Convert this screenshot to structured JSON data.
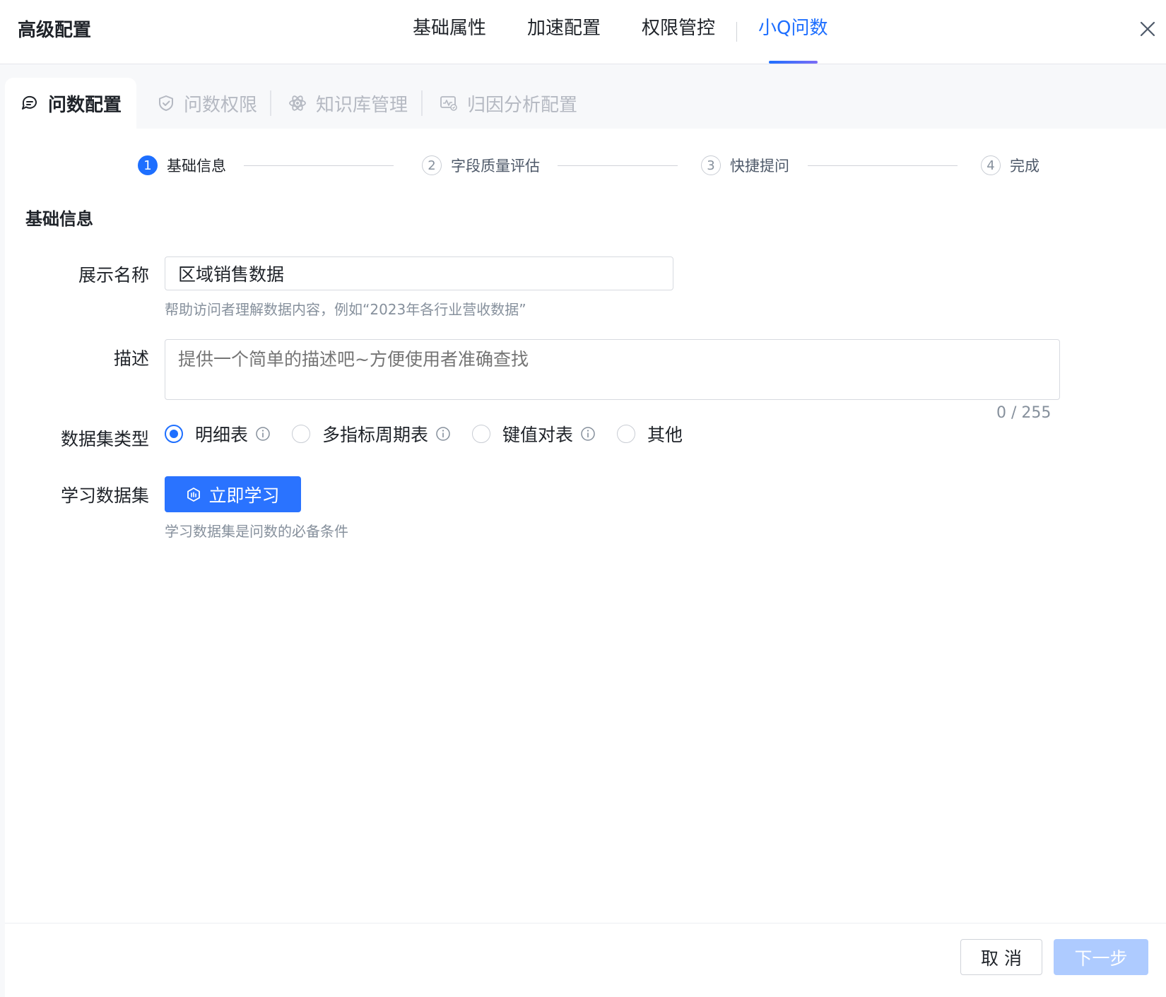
{
  "header": {
    "title": "高级配置",
    "tabs": [
      {
        "label": "基础属性"
      },
      {
        "label": "加速配置"
      },
      {
        "label": "权限管控"
      },
      {
        "label": "小Q问数",
        "active": true
      }
    ]
  },
  "subtabs": [
    {
      "label": "问数配置",
      "icon": "chat-icon",
      "active": true
    },
    {
      "label": "问数权限",
      "icon": "shield-icon"
    },
    {
      "label": "知识库管理",
      "icon": "atom-icon"
    },
    {
      "label": "归因分析配置",
      "icon": "chart-monitor-icon"
    }
  ],
  "steps": [
    {
      "num": "1",
      "label": "基础信息",
      "active": true
    },
    {
      "num": "2",
      "label": "字段质量评估"
    },
    {
      "num": "3",
      "label": "快捷提问"
    },
    {
      "num": "4",
      "label": "完成"
    }
  ],
  "form": {
    "section_title": "基础信息",
    "display_name_label": "展示名称",
    "display_name_value": "区域销售数据",
    "display_name_hint": "帮助访问者理解数据内容，例如“2023年各行业营收数据”",
    "description_label": "描述",
    "description_placeholder": "提供一个简单的描述吧~方便使用者准确查找",
    "description_counter": "0 / 255",
    "dataset_type_label": "数据集类型",
    "dataset_types": [
      {
        "label": "明细表",
        "selected": true,
        "info": true
      },
      {
        "label": "多指标周期表",
        "selected": false,
        "info": true
      },
      {
        "label": "键值对表",
        "selected": false,
        "info": true
      },
      {
        "label": "其他",
        "selected": false,
        "info": false
      }
    ],
    "learn_label": "学习数据集",
    "learn_button": "立即学习",
    "learn_hint": "学习数据集是问数的必备条件"
  },
  "footer": {
    "cancel": "取 消",
    "next": "下一步"
  },
  "colors": {
    "accent": "#1e6fff",
    "disabled_button": "#aecbff"
  }
}
